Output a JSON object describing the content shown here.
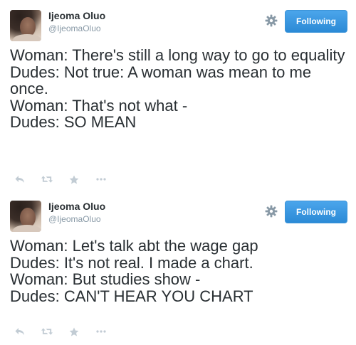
{
  "colors": {
    "follow_button": "#2b8ad6",
    "text": "#292f33",
    "muted": "#8899a6",
    "action_icon": "#c2ccd4"
  },
  "tweets": [
    {
      "author": {
        "name": "Ijeoma Oluo",
        "handle": "@IjeomaOluo"
      },
      "settings_icon": "gear-icon",
      "follow_label": "Following",
      "text": "Woman: There's still a long way to go to equality\nDudes: Not true: A woman was mean to me once.\nWoman: That's not what -\nDudes: SO MEAN",
      "actions": [
        "reply-icon",
        "retweet-icon",
        "favorite-icon",
        "more-icon"
      ]
    },
    {
      "author": {
        "name": "Ijeoma Oluo",
        "handle": "@IjeomaOluo"
      },
      "settings_icon": "gear-icon",
      "follow_label": "Following",
      "text": "Woman: Let's talk abt the wage gap\nDudes: It's not real. I made a chart.\nWoman: But studies show -\nDudes: CAN'T HEAR YOU CHART",
      "actions": [
        "reply-icon",
        "retweet-icon",
        "favorite-icon",
        "more-icon"
      ]
    }
  ]
}
